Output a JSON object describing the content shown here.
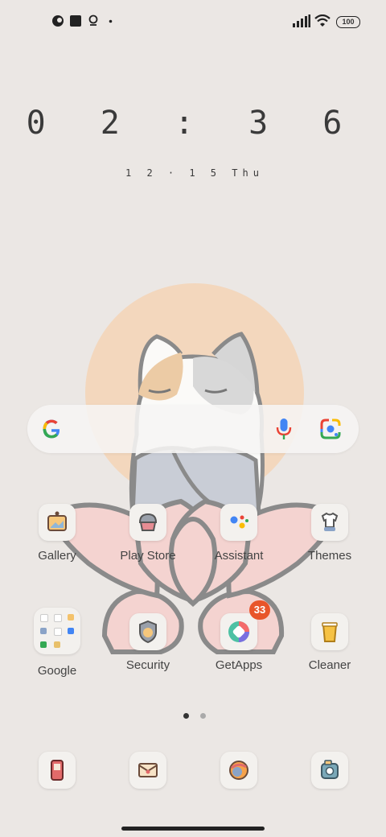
{
  "status": {
    "battery": "100",
    "left_icons": [
      "notification-icon",
      "stop-icon",
      "location-icon",
      "dot-icon"
    ],
    "right_icons": [
      "signal-icon",
      "wifi-icon",
      "battery-icon"
    ]
  },
  "clock": {
    "time": "0 2 : 3 6",
    "date": "1 2 · 1 5  Thu"
  },
  "search": {
    "icons": [
      "google-icon",
      "mic-icon",
      "lens-icon"
    ]
  },
  "apps": {
    "row1": [
      {
        "label": "Gallery"
      },
      {
        "label": "Play Store"
      },
      {
        "label": "Assistant"
      },
      {
        "label": "Themes"
      }
    ],
    "row2": [
      {
        "label": "Google"
      },
      {
        "label": "Security"
      },
      {
        "label": "GetApps",
        "badge": "33"
      },
      {
        "label": "Cleaner"
      }
    ]
  },
  "dock": {
    "icons": [
      "phone-icon",
      "messages-icon",
      "browser-icon",
      "camera-icon"
    ]
  },
  "pages": {
    "current": 1,
    "total": 2
  },
  "colors": {
    "background": "#ebe7e4",
    "badge": "#e8552a",
    "sun": "#f3d7bd",
    "lotus": "#f4d3d0"
  }
}
